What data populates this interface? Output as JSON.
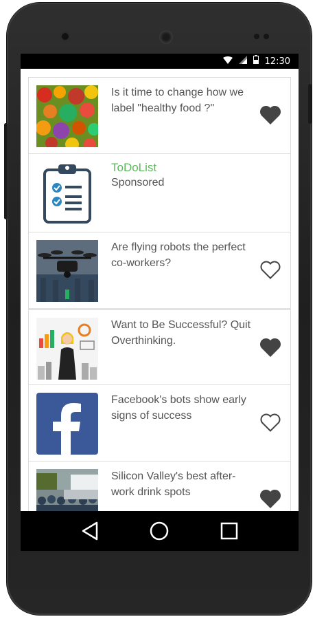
{
  "status_bar": {
    "time": "12:30",
    "icons": [
      "wifi-icon",
      "cell-signal-icon",
      "battery-icon"
    ]
  },
  "feed": {
    "items": [
      {
        "type": "article",
        "title": "Is it time to change how we label \"healthy food ?\"",
        "thumbnail": "vegetables-image",
        "liked": true
      },
      {
        "type": "ad",
        "name": "ToDoList",
        "label": "Sponsored",
        "icon": "clipboard-checklist-icon",
        "accent": "#5cb85c"
      },
      {
        "type": "article",
        "title": "Are flying robots the perfect co-workers?",
        "thumbnail": "drone-image",
        "liked": false
      },
      {
        "type": "article",
        "title": "Want to Be Successful? Quit Overthinking.",
        "thumbnail": "businesswoman-image",
        "liked": true
      },
      {
        "type": "article",
        "title": "Facebook's bots show early signs of success",
        "thumbnail": "facebook-logo-image",
        "liked": false
      },
      {
        "type": "article",
        "title": "Silicon Valley's best after-work drink spots",
        "thumbnail": "crowd-image",
        "liked": true
      }
    ]
  },
  "nav_bar": {
    "buttons": [
      "back-icon",
      "home-icon",
      "recents-icon"
    ]
  },
  "colors": {
    "ad_name": "#5cb85c",
    "heart": "#444444",
    "text": "#555555",
    "facebook_blue": "#3b5998"
  }
}
